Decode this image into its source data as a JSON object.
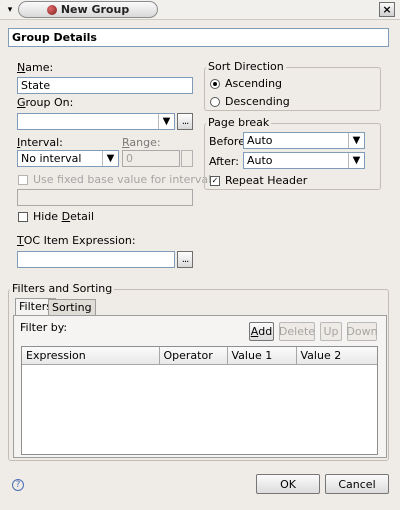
{
  "window": {
    "title": "New Group",
    "close_label": "×",
    "menu_label": "▾"
  },
  "header": "Group Details",
  "name": {
    "label": "Name:",
    "value": "State"
  },
  "group_on": {
    "label": "Group On:",
    "value": "",
    "browse": "..."
  },
  "interval": {
    "label": "Interval:",
    "value": "No interval"
  },
  "range": {
    "label": "Range:",
    "value": "0"
  },
  "fixed_base": {
    "label": "Use fixed base value for interval",
    "checked": false,
    "enabled": false,
    "value": ""
  },
  "hide_detail": {
    "label": "Hide Detail",
    "checked": false
  },
  "toc": {
    "label": "TOC Item Expression:",
    "value": "",
    "browse": "..."
  },
  "sort_direction": {
    "legend": "Sort Direction",
    "options": [
      {
        "label": "Ascending",
        "selected": true
      },
      {
        "label": "Descending",
        "selected": false
      }
    ]
  },
  "page_break": {
    "legend": "Page break",
    "before_label": "Before:",
    "before_value": "Auto",
    "after_label": "After:",
    "after_value": "Auto",
    "repeat_header_label": "Repeat Header",
    "repeat_header_checked": true
  },
  "filters_sorting": {
    "legend": "Filters and Sorting",
    "tabs": [
      {
        "label": "Filters",
        "active": true
      },
      {
        "label": "Sorting",
        "active": false
      }
    ],
    "filter_by_label": "Filter by:",
    "buttons": {
      "add": "Add",
      "delete": "Delete",
      "up": "Up",
      "down": "Down"
    },
    "columns": [
      "Expression",
      "Operator",
      "Value 1",
      "Value 2"
    ]
  },
  "footer": {
    "help": "?",
    "ok": "OK",
    "cancel": "Cancel"
  },
  "glyphs": {
    "arrow": "▼",
    "check": "✓"
  }
}
